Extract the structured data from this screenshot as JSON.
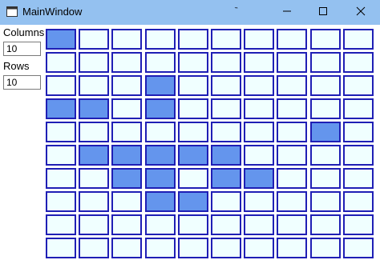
{
  "window": {
    "title": "MainWindow",
    "grip_glyph": "˵",
    "buttons": [
      {
        "name": "minimize-button",
        "icon": "minimize-icon"
      },
      {
        "name": "maximize-button",
        "icon": "maximize-icon"
      },
      {
        "name": "close-button",
        "icon": "close-icon"
      }
    ]
  },
  "controls": {
    "columns_label": "Columns",
    "columns_value": "10",
    "rows_label": "Rows",
    "rows_value": "10"
  },
  "board": {
    "columns": 10,
    "rows": 10,
    "cell_fill": "#f0ffff",
    "cell_border": "#1f1fb5",
    "active_fill": "#6495ed",
    "active_cells": [
      [
        0,
        0
      ],
      [
        3,
        2
      ],
      [
        0,
        3
      ],
      [
        1,
        3
      ],
      [
        3,
        3
      ],
      [
        8,
        4
      ],
      [
        1,
        5
      ],
      [
        2,
        5
      ],
      [
        3,
        5
      ],
      [
        4,
        5
      ],
      [
        5,
        5
      ],
      [
        2,
        6
      ],
      [
        3,
        6
      ],
      [
        5,
        6
      ],
      [
        6,
        6
      ],
      [
        3,
        7
      ],
      [
        4,
        7
      ]
    ]
  }
}
